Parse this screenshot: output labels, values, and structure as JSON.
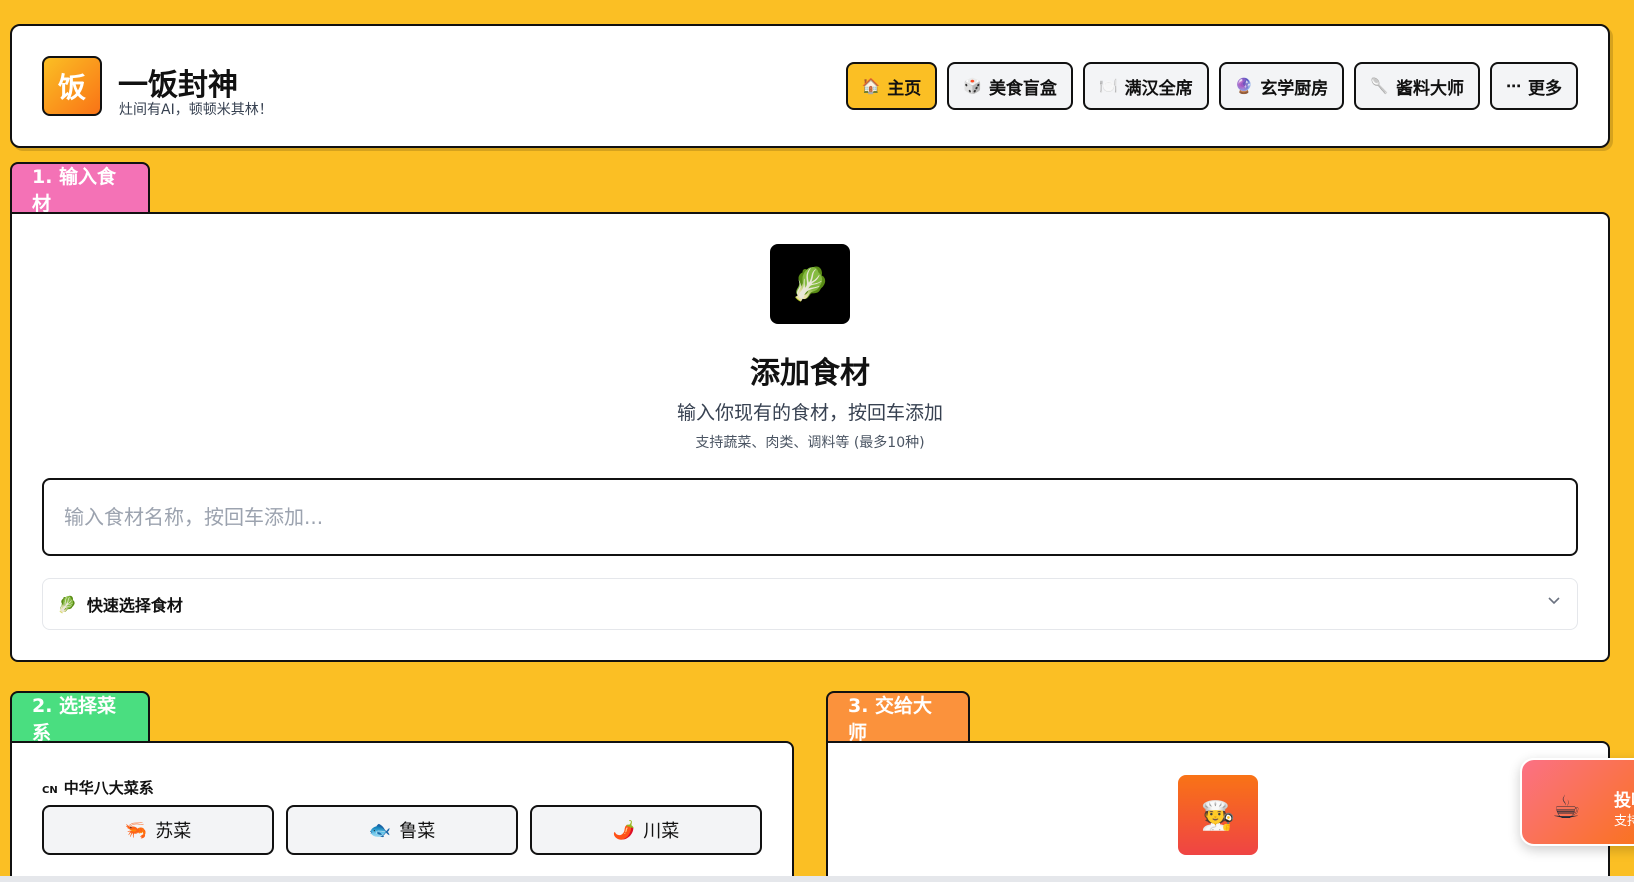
{
  "header": {
    "logo_char": "饭",
    "title": "一饭封神",
    "subtitle": "灶间有AI，顿顿米其林！",
    "nav": [
      {
        "icon": "🏠",
        "label": "主页",
        "active": true
      },
      {
        "icon": "🎲",
        "label": "美食盲盒"
      },
      {
        "icon": "🍽️",
        "label": "满汉全席"
      },
      {
        "icon": "🔮",
        "label": "玄学厨房"
      },
      {
        "icon": "🥄",
        "label": "酱料大师"
      },
      {
        "icon": "⋯",
        "label": "更多"
      }
    ]
  },
  "step1": {
    "tab": "1. 输入食材",
    "icon": "🥬",
    "title": "添加食材",
    "desc": "输入你现有的食材，按回车添加",
    "hint": "支持蔬菜、肉类、调料等 (最多10种)",
    "input_placeholder": "输入食材名称，按回车添加...",
    "quick_icon": "🥬",
    "quick_label": "快速选择食材"
  },
  "step2": {
    "tab": "2. 选择菜系",
    "group_tag": "CN",
    "group_title": "中华八大菜系",
    "cuisines": [
      {
        "icon": "🦐",
        "label": "苏菜"
      },
      {
        "icon": "🐟",
        "label": "鲁菜"
      },
      {
        "icon": "🌶️",
        "label": "川菜"
      }
    ]
  },
  "step3": {
    "tab": "3. 交给大师",
    "icon": "🧑‍🍳"
  },
  "donate": {
    "icon": "☕",
    "title": "投喂",
    "subtitle": "支持"
  },
  "colors": {
    "background": "#fbbf24",
    "tab1": "#f472b6",
    "tab2": "#4ade80",
    "tab3": "#fb923c"
  }
}
